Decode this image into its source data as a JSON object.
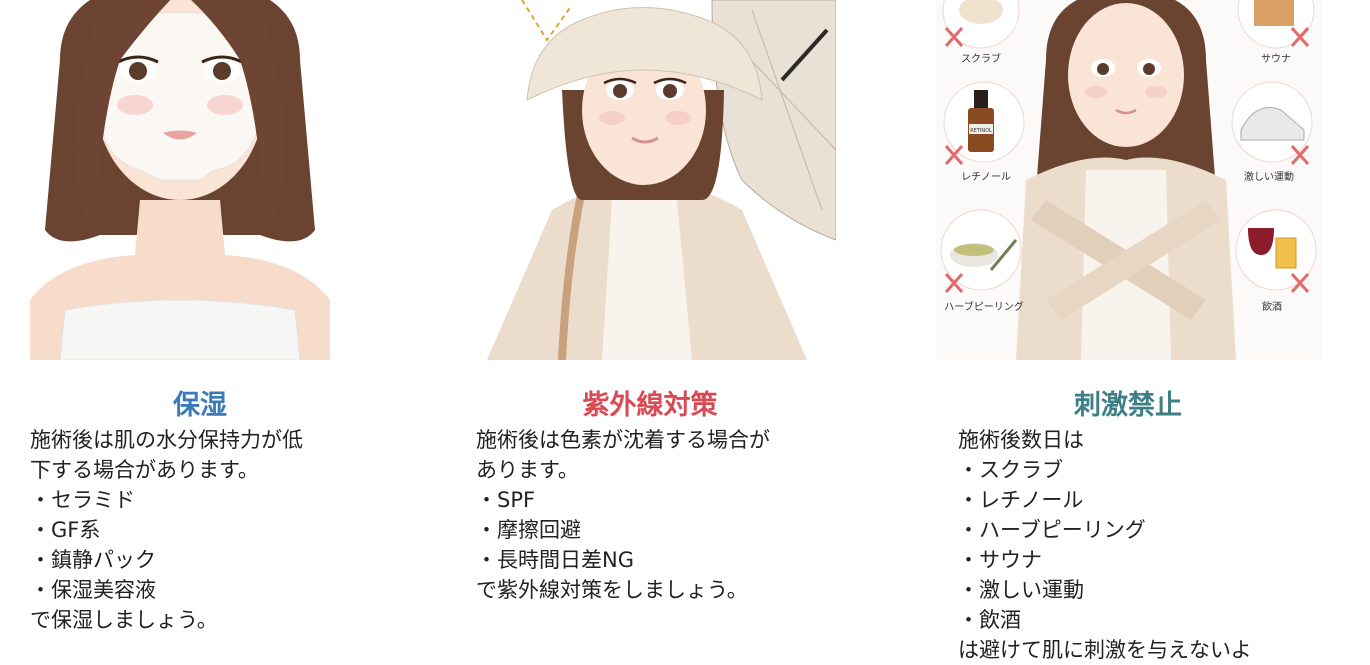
{
  "colors": {
    "hydration": "#3d7ab8",
    "uv": "#d94a55",
    "irritation": "#3e7f86",
    "text": "#222222"
  },
  "columns": [
    {
      "heading": "保湿",
      "lines": [
        "施術後は肌の水分保持力が低",
        "下する場合があります。",
        "・セラミド",
        "・GF系",
        "・鎮静パック",
        "・保湿美容液",
        "で保湿しましょう。"
      ]
    },
    {
      "heading": "紫外線対策",
      "lines": [
        "施術後は色素が沈着する場合が",
        "あります。",
        "・SPF",
        "・摩擦回避",
        "・長時間日差NG",
        "で紫外線対策をしましょう。"
      ]
    },
    {
      "heading": "刺激禁止",
      "lines": [
        "施術後数日は",
        "・スクラブ",
        "・レチノール",
        "・ハーブピーリング",
        "・サウナ",
        "・激しい運動",
        "・飲酒",
        "は避けて肌に刺激を与えないよ"
      ]
    }
  ],
  "illustration_labels": {
    "scrub": "スクラブ",
    "sauna": "サウナ",
    "retinol": "レチノール",
    "retinol_bottle": "RETINOL",
    "exercise": "激しい運動",
    "herb_peeling": "ハーブピーリング",
    "alcohol": "飲酒"
  }
}
